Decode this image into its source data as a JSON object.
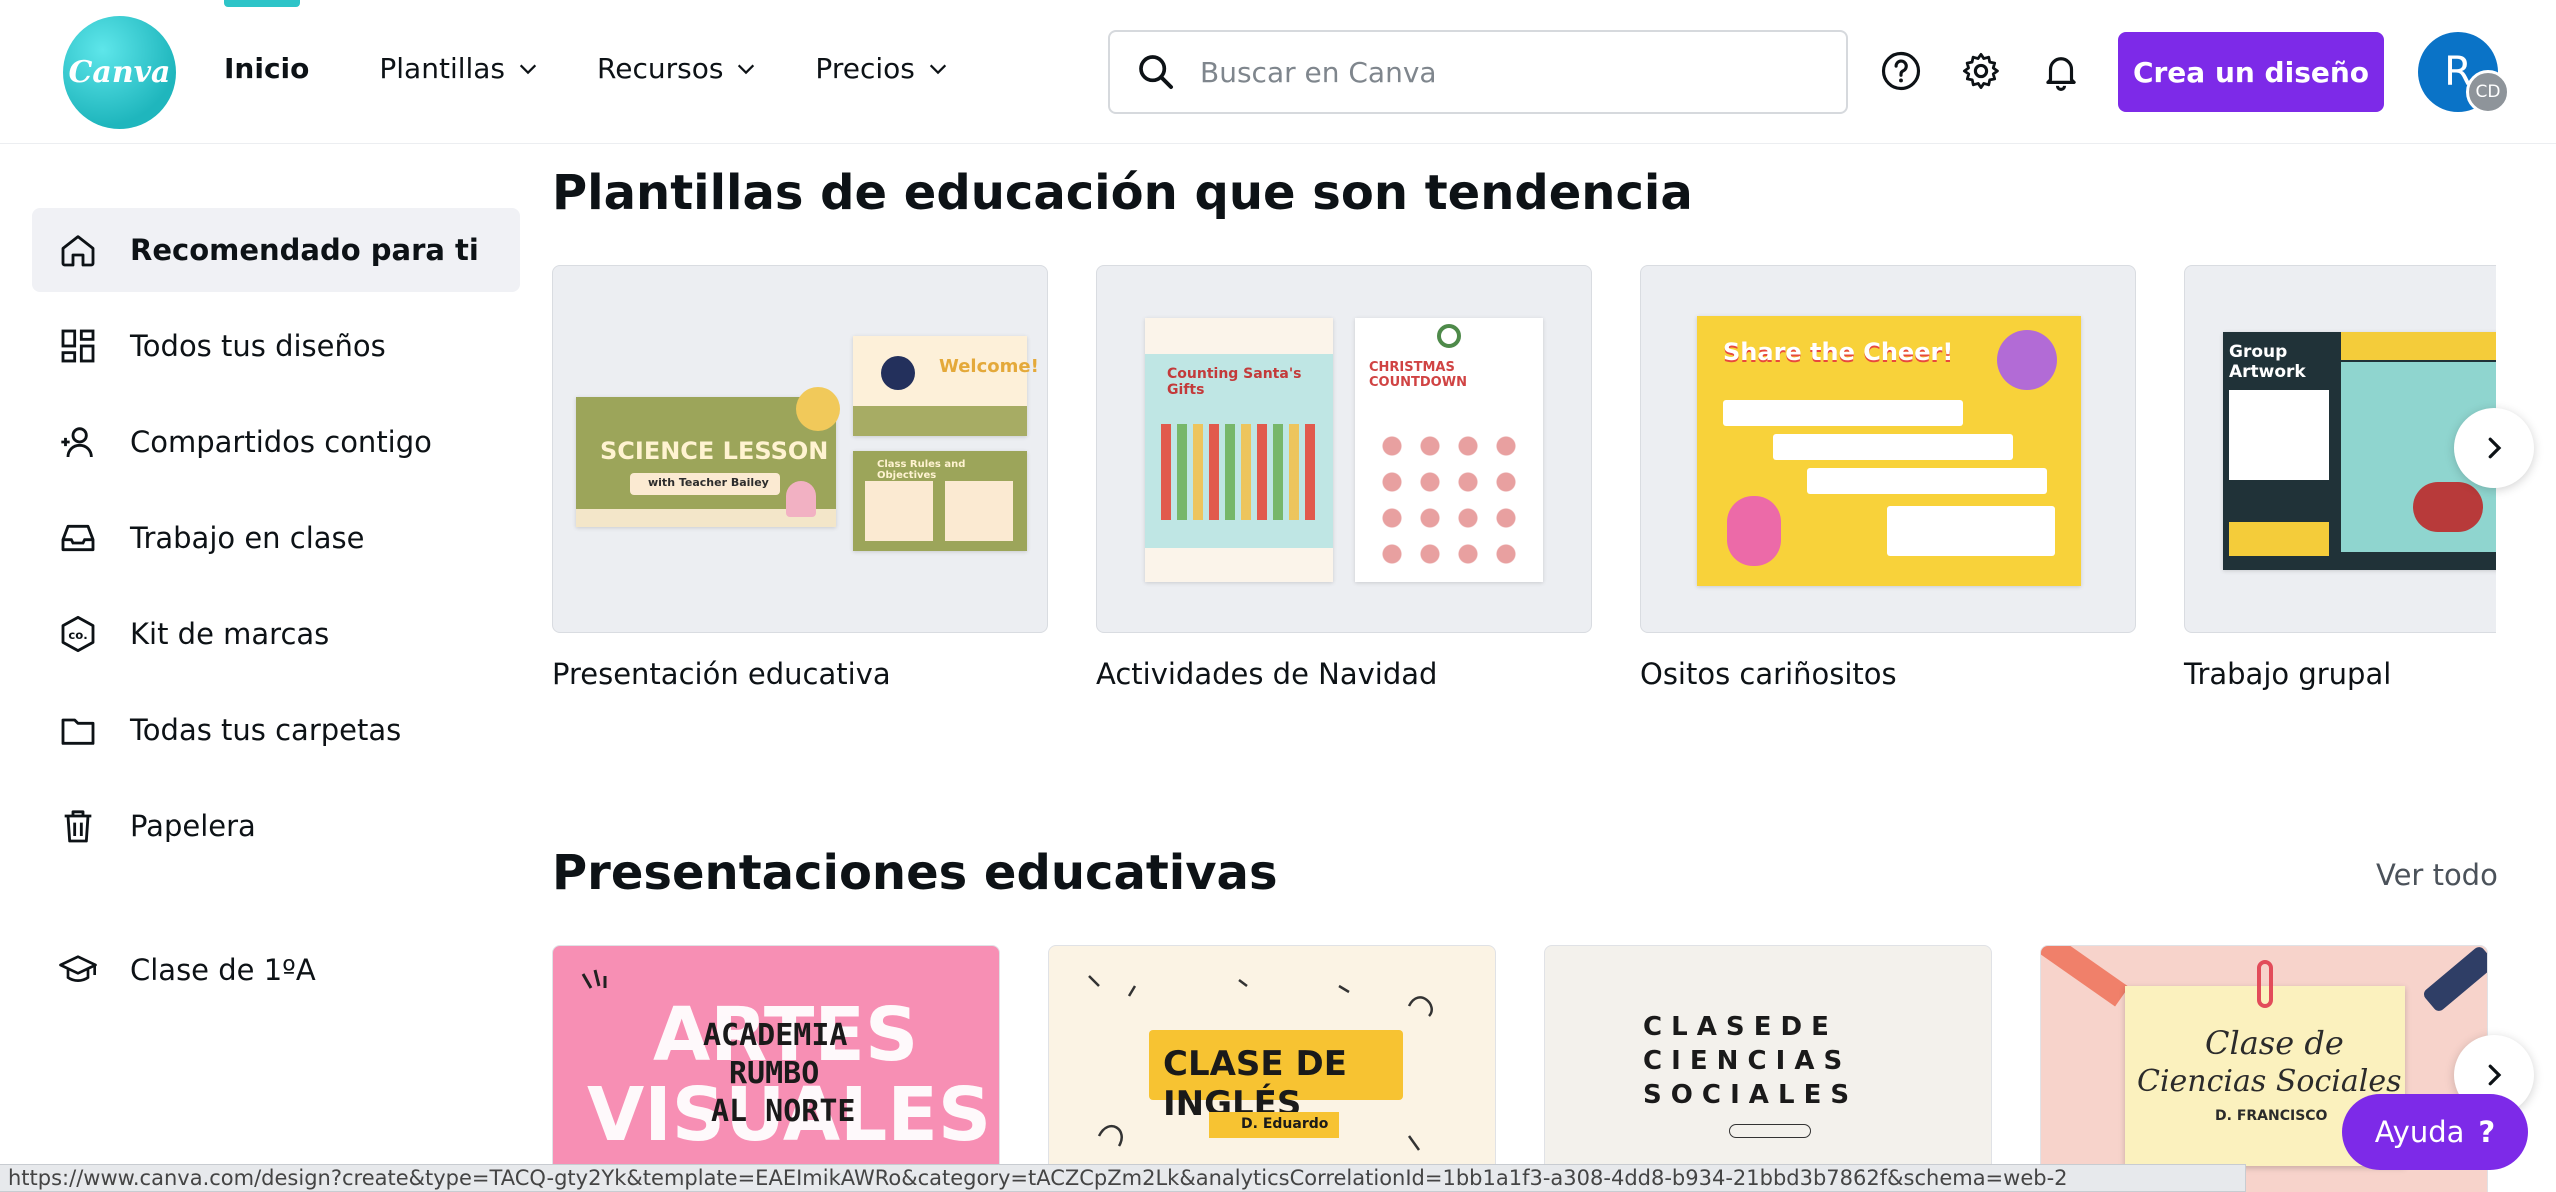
{
  "header": {
    "logo_text": "Canva",
    "nav": {
      "home": "Inicio",
      "templates": "Plantillas",
      "resources": "Recursos",
      "pricing": "Precios"
    },
    "search_placeholder": "Buscar en Canva",
    "create_button": "Crea un diseño",
    "avatar_initial": "R",
    "avatar_sub": "CD",
    "accent_color": "#7d2ae8",
    "brand_color": "#20c4cb"
  },
  "sidebar": {
    "items": [
      {
        "label": "Recomendado para ti",
        "icon": "home-icon"
      },
      {
        "label": "Todos tus diseños",
        "icon": "grid-icon"
      },
      {
        "label": "Compartidos contigo",
        "icon": "shared-users-icon"
      },
      {
        "label": "Trabajo en clase",
        "icon": "inbox-tray-icon"
      },
      {
        "label": "Kit de marcas",
        "icon": "brand-kit-icon"
      },
      {
        "label": "Todas tus carpetas",
        "icon": "folder-icon"
      },
      {
        "label": "Papelera",
        "icon": "trash-icon"
      }
    ],
    "class_item": {
      "label": "Clase de 1ºA",
      "icon": "graduation-cap-icon"
    }
  },
  "trending": {
    "title": "Plantillas de educación que son tendencia",
    "cards": [
      {
        "label": "Presentación educativa",
        "art_title": "SCIENCE LESSON",
        "art_sub": "with Teacher Bailey",
        "art_welcome": "Welcome!",
        "art_rules": "Class Rules and Objectives"
      },
      {
        "label": "Actividades de Navidad",
        "art_title": "Counting Santa's Gifts",
        "art_title2": "CHRISTMAS COUNTDOWN"
      },
      {
        "label": "Ositos cariñositos",
        "art_title": "Share the Cheer!"
      },
      {
        "label": "Trabajo grupal",
        "art_title": "Group Artwork"
      }
    ]
  },
  "presentations": {
    "title": "Presentaciones educativas",
    "see_all": "Ver todo",
    "items": [
      {
        "line1": "ARTES",
        "line2": "VISUALES",
        "overlay1": "ACADEMIA",
        "overlay2": "RUMBO",
        "overlay3": "AL NORTE"
      },
      {
        "title": "CLASE DE INGLÉS",
        "teacher": "D. Eduardo"
      },
      {
        "title1": "C L A S E  D E",
        "title2": "C I E N C I A S",
        "title3": "S O C I A L E S"
      },
      {
        "title1": "Clase de",
        "title2": "Ciencias Sociales",
        "teacher": "D. FRANCISCO"
      }
    ]
  },
  "help_button": "Ayuda",
  "status_url": "https://www.canva.com/design?create&type=TACQ-gty2Yk&template=EAEImikAWRo&category=tACZCpZm2Lk&analyticsCorrelationId=1bb1a1f3-a308-4dd8-b934-21bbd3b7862f&schema=web-2"
}
